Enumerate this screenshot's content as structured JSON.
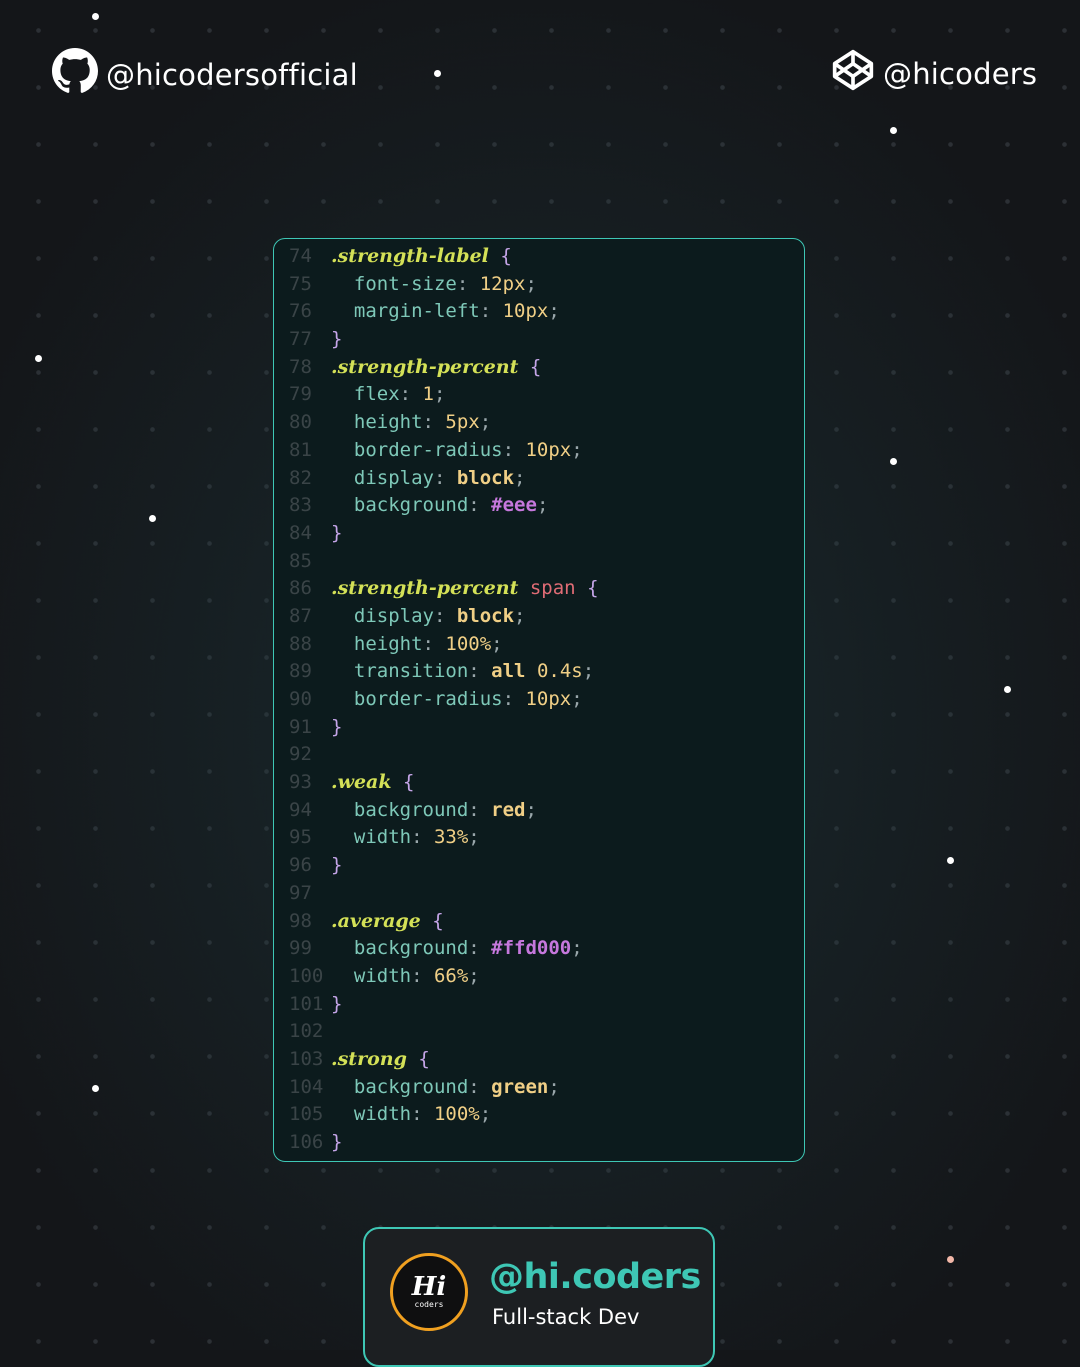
{
  "header": {
    "github_handle": "@hicodersofficial",
    "codepen_handle": "@hicoders",
    "github_icon": "github-icon",
    "codepen_icon": "codepen-icon"
  },
  "code": {
    "lines": [
      {
        "n": "74",
        "tokens": [
          [
            "sel",
            ".strength-label"
          ],
          [
            "pun",
            " "
          ],
          [
            "br",
            "{"
          ]
        ]
      },
      {
        "n": "75",
        "tokens": [
          [
            "prop",
            "  font-size"
          ],
          [
            "pun",
            ": "
          ],
          [
            "num",
            "12px"
          ],
          [
            "pun",
            ";"
          ]
        ]
      },
      {
        "n": "76",
        "tokens": [
          [
            "prop",
            "  margin-left"
          ],
          [
            "pun",
            ": "
          ],
          [
            "num",
            "10px"
          ],
          [
            "pun",
            ";"
          ]
        ]
      },
      {
        "n": "77",
        "tokens": [
          [
            "br",
            "}"
          ]
        ]
      },
      {
        "n": "78",
        "tokens": [
          [
            "sel",
            ".strength-percent"
          ],
          [
            "pun",
            " "
          ],
          [
            "br",
            "{"
          ]
        ]
      },
      {
        "n": "79",
        "tokens": [
          [
            "prop",
            "  flex"
          ],
          [
            "pun",
            ": "
          ],
          [
            "num",
            "1"
          ],
          [
            "pun",
            ";"
          ]
        ]
      },
      {
        "n": "80",
        "tokens": [
          [
            "prop",
            "  height"
          ],
          [
            "pun",
            ": "
          ],
          [
            "num",
            "5px"
          ],
          [
            "pun",
            ";"
          ]
        ]
      },
      {
        "n": "81",
        "tokens": [
          [
            "prop",
            "  border-radius"
          ],
          [
            "pun",
            ": "
          ],
          [
            "num",
            "10px"
          ],
          [
            "pun",
            ";"
          ]
        ]
      },
      {
        "n": "82",
        "tokens": [
          [
            "prop",
            "  display"
          ],
          [
            "pun",
            ": "
          ],
          [
            "kw",
            "block"
          ],
          [
            "pun",
            ";"
          ]
        ]
      },
      {
        "n": "83",
        "tokens": [
          [
            "prop",
            "  background"
          ],
          [
            "pun",
            ": "
          ],
          [
            "hex",
            "#eee"
          ],
          [
            "pun",
            ";"
          ]
        ]
      },
      {
        "n": "84",
        "tokens": [
          [
            "br",
            "}"
          ]
        ]
      },
      {
        "n": "85",
        "tokens": []
      },
      {
        "n": "86",
        "tokens": [
          [
            "sel",
            ".strength-percent"
          ],
          [
            "pun",
            " "
          ],
          [
            "tag",
            "span"
          ],
          [
            "pun",
            " "
          ],
          [
            "br",
            "{"
          ]
        ]
      },
      {
        "n": "87",
        "tokens": [
          [
            "prop",
            "  display"
          ],
          [
            "pun",
            ": "
          ],
          [
            "kw",
            "block"
          ],
          [
            "pun",
            ";"
          ]
        ]
      },
      {
        "n": "88",
        "tokens": [
          [
            "prop",
            "  height"
          ],
          [
            "pun",
            ": "
          ],
          [
            "num",
            "100%"
          ],
          [
            "pun",
            ";"
          ]
        ]
      },
      {
        "n": "89",
        "tokens": [
          [
            "prop",
            "  transition"
          ],
          [
            "pun",
            ": "
          ],
          [
            "kw",
            "all"
          ],
          [
            "pun",
            " "
          ],
          [
            "num",
            "0.4s"
          ],
          [
            "pun",
            ";"
          ]
        ]
      },
      {
        "n": "90",
        "tokens": [
          [
            "prop",
            "  border-radius"
          ],
          [
            "pun",
            ": "
          ],
          [
            "num",
            "10px"
          ],
          [
            "pun",
            ";"
          ]
        ]
      },
      {
        "n": "91",
        "tokens": [
          [
            "br",
            "}"
          ]
        ]
      },
      {
        "n": "92",
        "tokens": []
      },
      {
        "n": "93",
        "tokens": [
          [
            "sel",
            ".weak"
          ],
          [
            "pun",
            " "
          ],
          [
            "br",
            "{"
          ]
        ]
      },
      {
        "n": "94",
        "tokens": [
          [
            "prop",
            "  background"
          ],
          [
            "pun",
            ": "
          ],
          [
            "kw",
            "red"
          ],
          [
            "pun",
            ";"
          ]
        ]
      },
      {
        "n": "95",
        "tokens": [
          [
            "prop",
            "  width"
          ],
          [
            "pun",
            ": "
          ],
          [
            "num",
            "33%"
          ],
          [
            "pun",
            ";"
          ]
        ]
      },
      {
        "n": "96",
        "tokens": [
          [
            "br",
            "}"
          ]
        ]
      },
      {
        "n": "97",
        "tokens": []
      },
      {
        "n": "98",
        "tokens": [
          [
            "sel",
            ".average"
          ],
          [
            "pun",
            " "
          ],
          [
            "br",
            "{"
          ]
        ]
      },
      {
        "n": "99",
        "tokens": [
          [
            "prop",
            "  background"
          ],
          [
            "pun",
            ": "
          ],
          [
            "hex",
            "#ffd000"
          ],
          [
            "pun",
            ";"
          ]
        ]
      },
      {
        "n": "100",
        "tokens": [
          [
            "prop",
            "  width"
          ],
          [
            "pun",
            ": "
          ],
          [
            "num",
            "66%"
          ],
          [
            "pun",
            ";"
          ]
        ]
      },
      {
        "n": "101",
        "tokens": [
          [
            "br",
            "}"
          ]
        ]
      },
      {
        "n": "102",
        "tokens": []
      },
      {
        "n": "103",
        "tokens": [
          [
            "sel",
            ".strong"
          ],
          [
            "pun",
            " "
          ],
          [
            "br",
            "{"
          ]
        ]
      },
      {
        "n": "104",
        "tokens": [
          [
            "prop",
            "  background"
          ],
          [
            "pun",
            ": "
          ],
          [
            "kw",
            "green"
          ],
          [
            "pun",
            ";"
          ]
        ]
      },
      {
        "n": "105",
        "tokens": [
          [
            "prop",
            "  width"
          ],
          [
            "pun",
            ": "
          ],
          [
            "num",
            "100%"
          ],
          [
            "pun",
            ";"
          ]
        ]
      },
      {
        "n": "106",
        "tokens": [
          [
            "br",
            "}"
          ]
        ]
      }
    ]
  },
  "brand": {
    "logo_main": "Hi",
    "logo_sub": "coders",
    "name": "@hi.coders",
    "role": "Full-stack Dev"
  },
  "colors": {
    "accent": "#3ec7b5",
    "logo_ring": "#f0a020",
    "background": "#141619"
  }
}
